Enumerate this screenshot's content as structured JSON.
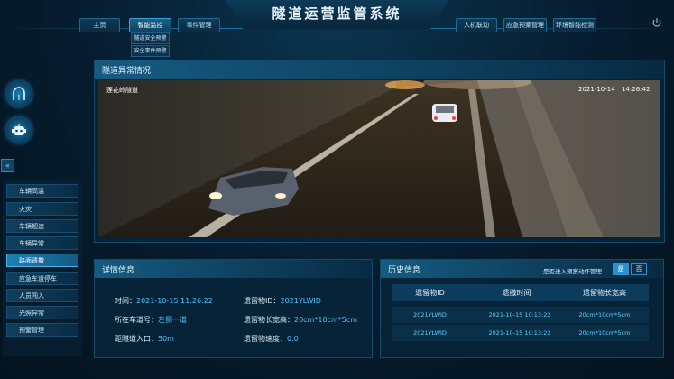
{
  "header": {
    "title": "隧道运营监管系统",
    "nav_left": [
      "主页",
      "智能监控",
      "事件管理"
    ],
    "nav_right": [
      "人机联动",
      "应急预案管理",
      "环境智能检测"
    ],
    "submenu": [
      "隧道安全预警",
      "安全事件预警"
    ]
  },
  "sidebar": {
    "collapse": "«",
    "items": [
      "车辆高温",
      "火灾",
      "车辆超速",
      "车辆异常",
      "路面遗撒",
      "应急车道停车",
      "人员闯入",
      "光照异常",
      "预警管理"
    ],
    "active_index": 4
  },
  "video_panel": {
    "title": "隧道异常情况",
    "camera_name": "莲花岭隧道",
    "date": "2021-10-14",
    "time": "14:26:42"
  },
  "detail_panel": {
    "title": "详情信息",
    "time_label": "时间：",
    "time_value": "2021-10-15  11:26:22",
    "lane_label": "所在车道号：",
    "lane_value": "左侧一道",
    "distance_label": "距隧道入口：",
    "distance_value": "50m",
    "object_id_label": "遗留物ID：",
    "object_id_value": "2021YLWID",
    "size_label": "遗留物长宽高：",
    "size_value": "20cm*10cm*5cm",
    "speed_label": "遗留物速度：",
    "speed_value": "0.0"
  },
  "history_panel": {
    "title": "历史信息",
    "switch_label": "是否进入预案动作管理",
    "yes": "是",
    "no": "否",
    "columns": [
      "遗留物ID",
      "遗撒时间",
      "遗留物长宽高"
    ],
    "rows": [
      [
        "2021YLWID",
        "2021-10-15 10:13:22",
        "20cm*10cm*5cm"
      ],
      [
        "2021YLWID",
        "2021-10-15 10:13:22",
        "20cm*10cm*5cm"
      ]
    ]
  },
  "colors": {
    "accent": "#4ec7ff",
    "background": "#061c2e",
    "active": "#1f7fb3"
  },
  "icons": {
    "power": "power-icon",
    "tunnel": "tunnel-icon",
    "robot": "robot-icon"
  }
}
